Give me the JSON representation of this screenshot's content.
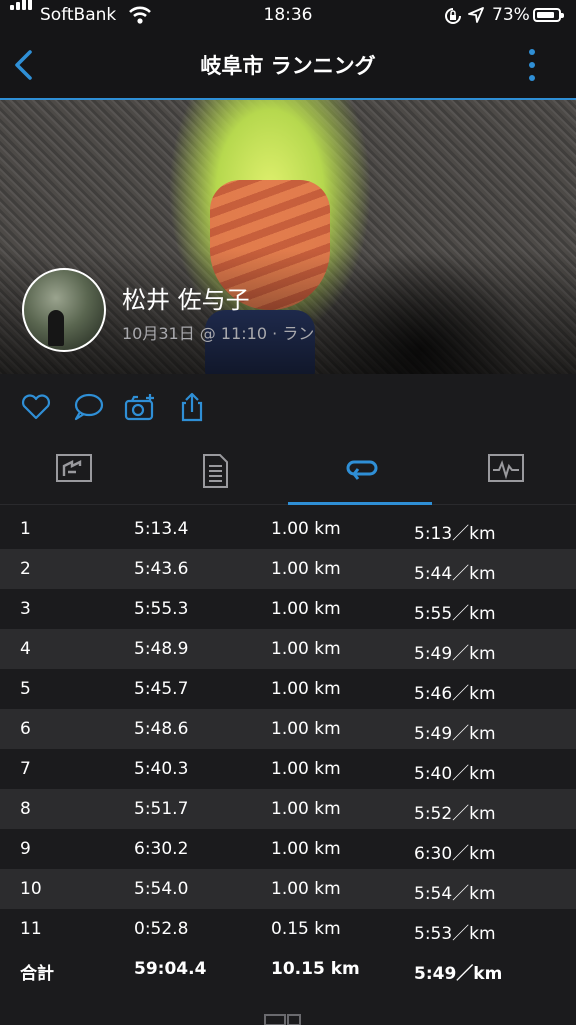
{
  "status_bar": {
    "carrier": "SoftBank",
    "time": "18:36",
    "battery_pct": "73%",
    "icons": [
      "signal-icon",
      "wifi-icon",
      "orientation-lock-icon",
      "location-icon",
      "battery-icon"
    ]
  },
  "nav": {
    "title": "岐阜市 ランニング",
    "back_icon": "chevron-left-icon",
    "more_icon": "more-vertical-icon",
    "accent": "#2f8fd6"
  },
  "activity": {
    "user_name": "松井 佐与子",
    "meta": "10月31日 @ 11:10 · ラン"
  },
  "actions": [
    "heart-icon",
    "comment-icon",
    "add-photo-icon",
    "share-icon"
  ],
  "tabs": [
    {
      "icon": "summary-icon",
      "active": false
    },
    {
      "icon": "details-icon",
      "active": false
    },
    {
      "icon": "laps-icon",
      "active": true
    },
    {
      "icon": "chart-icon",
      "active": false
    }
  ],
  "laps": [
    {
      "lap": "1",
      "time": "5:13.4",
      "distance": "1.00 km",
      "pace": "5:13／km"
    },
    {
      "lap": "2",
      "time": "5:43.6",
      "distance": "1.00 km",
      "pace": "5:44／km"
    },
    {
      "lap": "3",
      "time": "5:55.3",
      "distance": "1.00 km",
      "pace": "5:55／km"
    },
    {
      "lap": "4",
      "time": "5:48.9",
      "distance": "1.00 km",
      "pace": "5:49／km"
    },
    {
      "lap": "5",
      "time": "5:45.7",
      "distance": "1.00 km",
      "pace": "5:46／km"
    },
    {
      "lap": "6",
      "time": "5:48.6",
      "distance": "1.00 km",
      "pace": "5:49／km"
    },
    {
      "lap": "7",
      "time": "5:40.3",
      "distance": "1.00 km",
      "pace": "5:40／km"
    },
    {
      "lap": "8",
      "time": "5:51.7",
      "distance": "1.00 km",
      "pace": "5:52／km"
    },
    {
      "lap": "9",
      "time": "6:30.2",
      "distance": "1.00 km",
      "pace": "6:30／km"
    },
    {
      "lap": "10",
      "time": "5:54.0",
      "distance": "1.00 km",
      "pace": "5:54／km"
    },
    {
      "lap": "11",
      "time": "0:52.8",
      "distance": "0.15 km",
      "pace": "5:53／km"
    }
  ],
  "total": {
    "label": "合計",
    "time": "59:04.4",
    "distance": "10.15 km",
    "pace": "5:49／km"
  }
}
